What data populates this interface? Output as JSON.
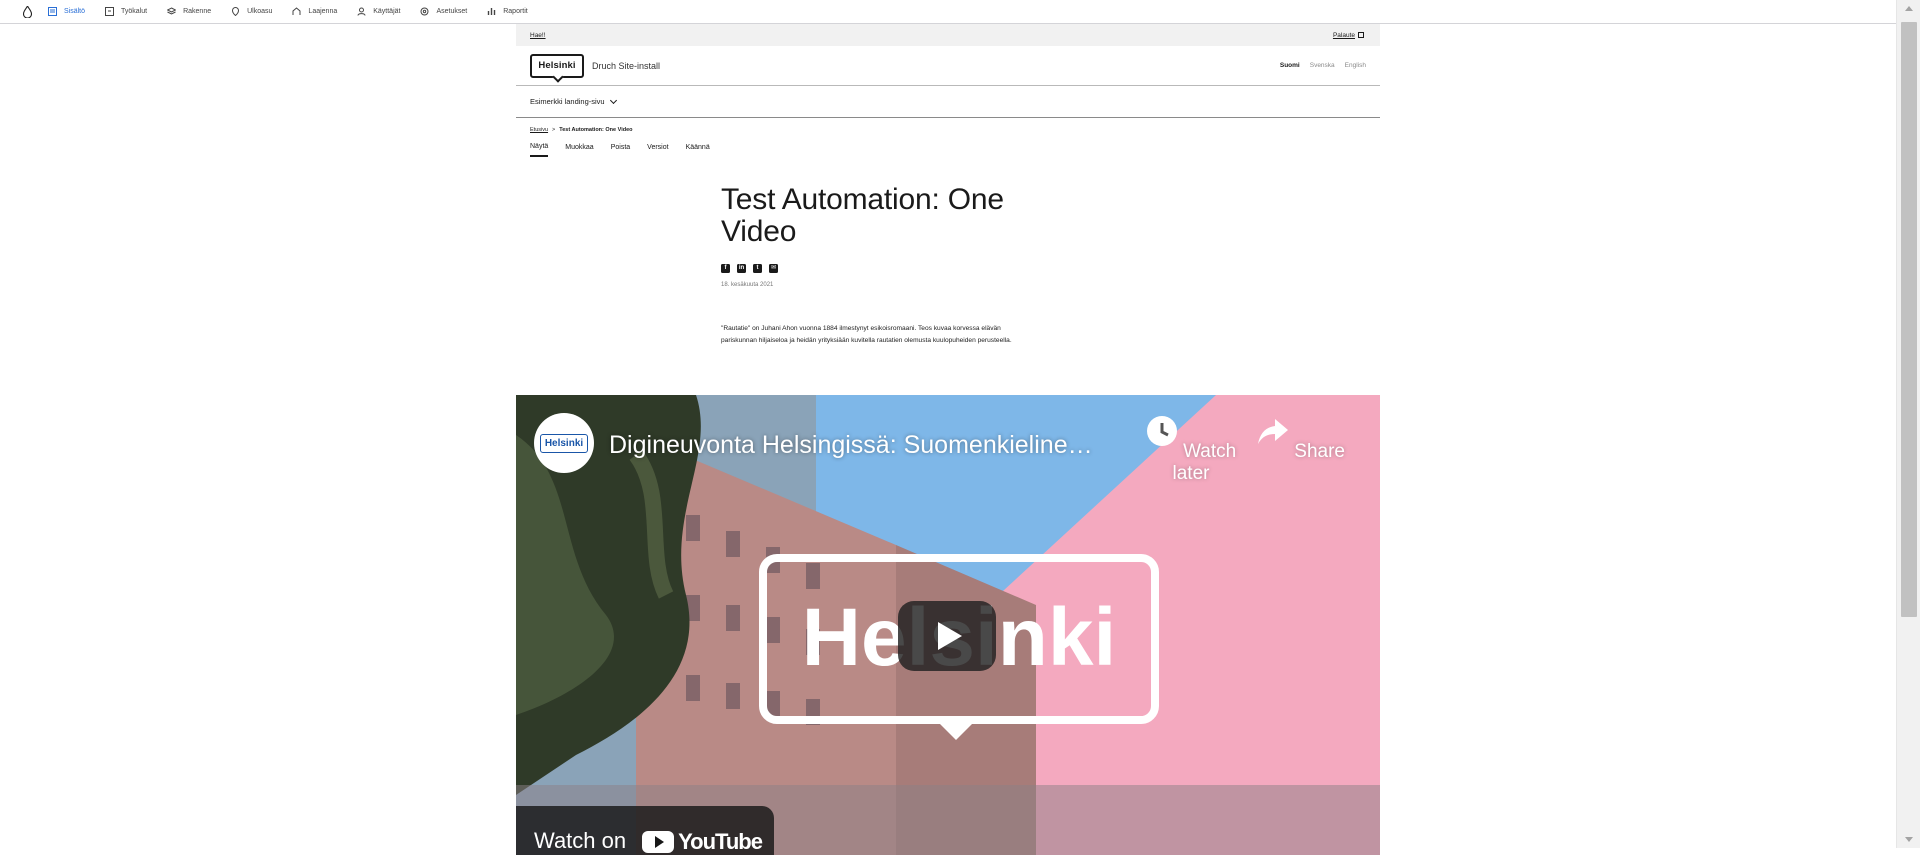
{
  "toolbar": {
    "items": [
      {
        "label": "Sisältö",
        "icon": "content-icon"
      },
      {
        "label": "Työkalut",
        "icon": "tools-icon"
      },
      {
        "label": "Rakenne",
        "icon": "structure-icon"
      },
      {
        "label": "Ulkoasu",
        "icon": "appearance-icon"
      },
      {
        "label": "Laajenna",
        "icon": "extend-icon"
      },
      {
        "label": "Käyttäjät",
        "icon": "people-icon"
      },
      {
        "label": "Asetukset",
        "icon": "config-icon"
      },
      {
        "label": "Raportit",
        "icon": "reports-icon"
      }
    ]
  },
  "topbar": {
    "left_link": "Hae!!",
    "right_link": "Palaute"
  },
  "header": {
    "logo_text": "Helsinki",
    "site_name": "Druch Site-install",
    "languages": [
      "Suomi",
      "Svenska",
      "English"
    ]
  },
  "mainnav": {
    "item": "Esimerkki landing-sivu"
  },
  "breadcrumb": {
    "home": "Etusivu",
    "separator": ">",
    "current": "Test Automation: One Video"
  },
  "tabs": [
    "Näytä",
    "Muokkaa",
    "Poista",
    "Versiot",
    "Käännä"
  ],
  "article": {
    "title": "Test Automation: One Video",
    "share_icons": [
      "f",
      "in",
      "t",
      "✉"
    ],
    "date": "18. kesäkuuta 2021",
    "lead": "\"Rautatie\" on Juhani Ahon vuonna 1884 ilmestynyt esikoisromaani. Teos kuvaa korvessa elävän pariskunnan hiljaiseloa ja heidän yrityksiään kuvitella rautatien olemusta kuulopuheiden perusteella."
  },
  "video": {
    "channel_logo": "Helsinki",
    "title": "Digineuvonta Helsingissä: Suomenkieline…",
    "watch_later": "Watch later",
    "share": "Share",
    "thumbnail_text": "Helsinki",
    "watch_on": "Watch on",
    "youtube": "YouTube"
  },
  "colors": {
    "accent": "#2a6fd6",
    "pink": "#f4a9bf",
    "sky": "#7eb7e8"
  }
}
